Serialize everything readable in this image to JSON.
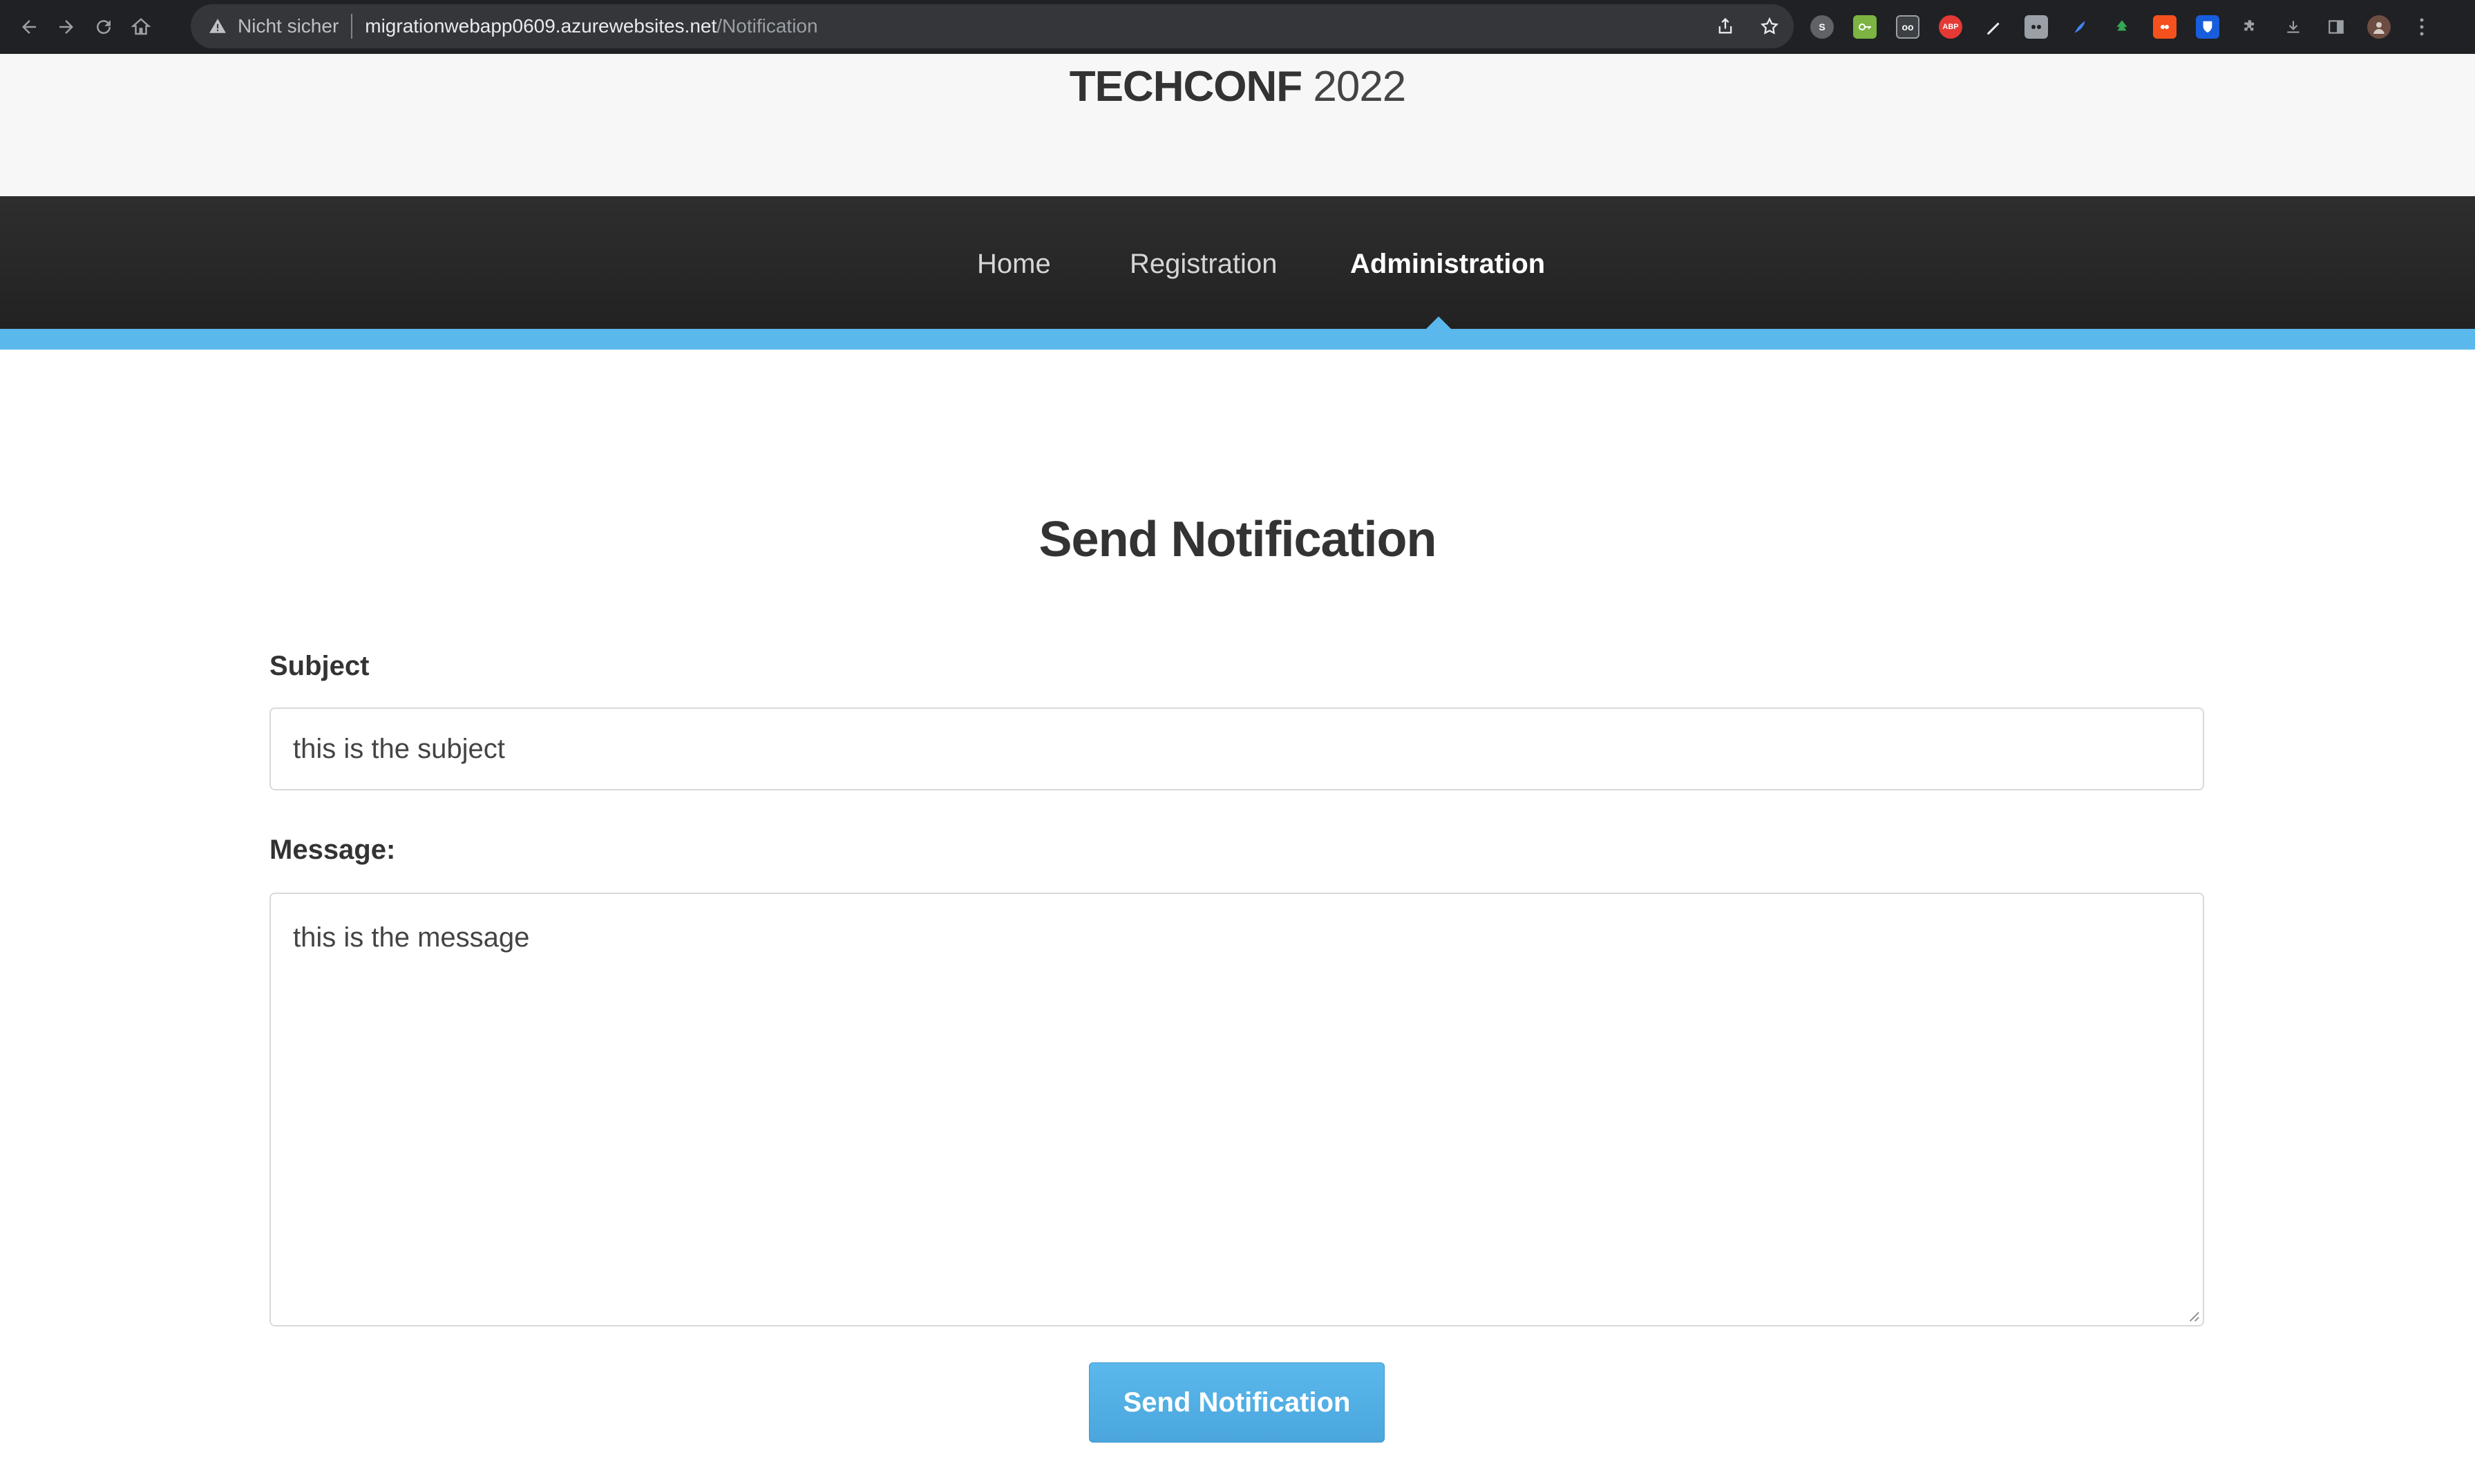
{
  "browser": {
    "security_text": "Nicht sicher",
    "url_host": "migrationwebapp0609.azurewebsites.net",
    "url_path": "/Notification",
    "extension_labels": [
      "S",
      "ABP",
      "oo"
    ]
  },
  "site": {
    "brand_bold": "TECHCONF",
    "brand_year": "2022"
  },
  "nav": {
    "items": [
      {
        "label": "Home"
      },
      {
        "label": "Registration"
      },
      {
        "label": "Administration",
        "active": true
      }
    ]
  },
  "form": {
    "title": "Send Notification",
    "subject_label": "Subject",
    "subject_value": "this is the subject",
    "message_label": "Message:",
    "message_value": "this is the message",
    "submit_label": "Send Notification"
  },
  "colors": {
    "accent": "#5bb8ec",
    "navbar": "#262626",
    "header_bg": "#f7f7f7"
  }
}
